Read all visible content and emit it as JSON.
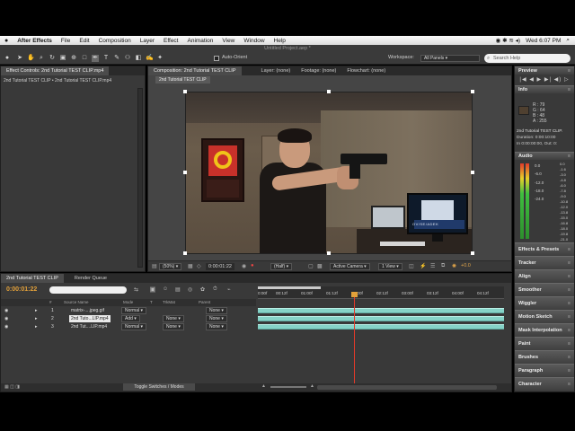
{
  "menubar": {
    "apple": "",
    "app_name": "After Effects",
    "items": [
      "File",
      "Edit",
      "Composition",
      "Layer",
      "Effect",
      "Animation",
      "View",
      "Window",
      "Help"
    ],
    "clock": "Wed 6:07 PM"
  },
  "project_title": "Untitled Project.aep *",
  "toolbar": {
    "autoorient_label": "Auto-Orient",
    "workspace_label": "Workspace:",
    "workspace_value": "All Panels",
    "search_placeholder": "Search Help"
  },
  "left_panel": {
    "tab_label": "Effect Controls: 2nd Tutorial TEST CLIP.mp4",
    "breadcrumb": "2nd Tutorial TEST CLIP • 2nd Tutorial TEST CLIP.mp4"
  },
  "viewer": {
    "tabs": [
      "Composition: 2nd Tutorial TEST CLIP",
      "Layer: (none)",
      "Footage: (none)",
      "Flowchart: (none)"
    ],
    "comp_label": "2nd Tutorial TEST CLIP",
    "zoom": "(50%)",
    "timecode": "0:00:01:22",
    "resolution": "(Half)",
    "camera": "Active Camera",
    "views": "1 View",
    "exposure": "+0.0",
    "poster_text": "OV/SE/ADEK"
  },
  "right_panels": {
    "preview": "Preview",
    "info": "Info",
    "info_values": [
      "R : 79",
      "G : 64",
      "B : 48",
      "A : 255"
    ],
    "info_meta": [
      "2nd Tutorial TEST CLIP.",
      "Duration: 0:00:10:00",
      "In 0:00:00:00, Out: 0:"
    ],
    "audio": "Audio",
    "audio_scale": [
      "0.0",
      "-6.0",
      "-12.0",
      "-18.0",
      "-24.0"
    ],
    "audio_db": [
      "0.0",
      "-1.6",
      "-3.0",
      "-4.8",
      "-6.0",
      "-7.8",
      "-9.0",
      "-10.8",
      "-12.0",
      "-13.8",
      "-15.0",
      "-16.8",
      "-18.0",
      "-19.8",
      "-21.0"
    ],
    "stack": [
      "Effects & Presets",
      "Tracker",
      "Align",
      "Smoother",
      "Wiggler",
      "Motion Sketch",
      "Mask Interpolation",
      "Paint",
      "Brushes",
      "Paragraph",
      "Character"
    ]
  },
  "timeline": {
    "tabs": [
      "2nd Tutorial TEST CLIP",
      "Render Queue"
    ],
    "timecode": "0:00:01:22",
    "columns": [
      "#",
      "Source Name",
      "Mode",
      "T",
      "TrkMat",
      "Parent"
    ],
    "layers": [
      {
        "num": "1",
        "name": "matrix-....jpeg.gif",
        "mode": "Normal",
        "trkmat": "",
        "parent": "None"
      },
      {
        "num": "2",
        "name": "2nd Tuto...LIP.mp4",
        "mode": "Add",
        "trkmat": "None",
        "parent": "None"
      },
      {
        "num": "3",
        "name": "2nd Tut....LIP.mp4",
        "mode": "Normal",
        "trkmat": "None",
        "parent": "None"
      }
    ],
    "ruler_labels": [
      "0:00f",
      "00:12f",
      "01:00f",
      "01:12f",
      "02:00f",
      "02:12f",
      "03:00f",
      "03:12f",
      "04:00f",
      "04:12f"
    ],
    "toggle_label": "Toggle Switches / Modes",
    "playhead_fraction": 0.39
  }
}
